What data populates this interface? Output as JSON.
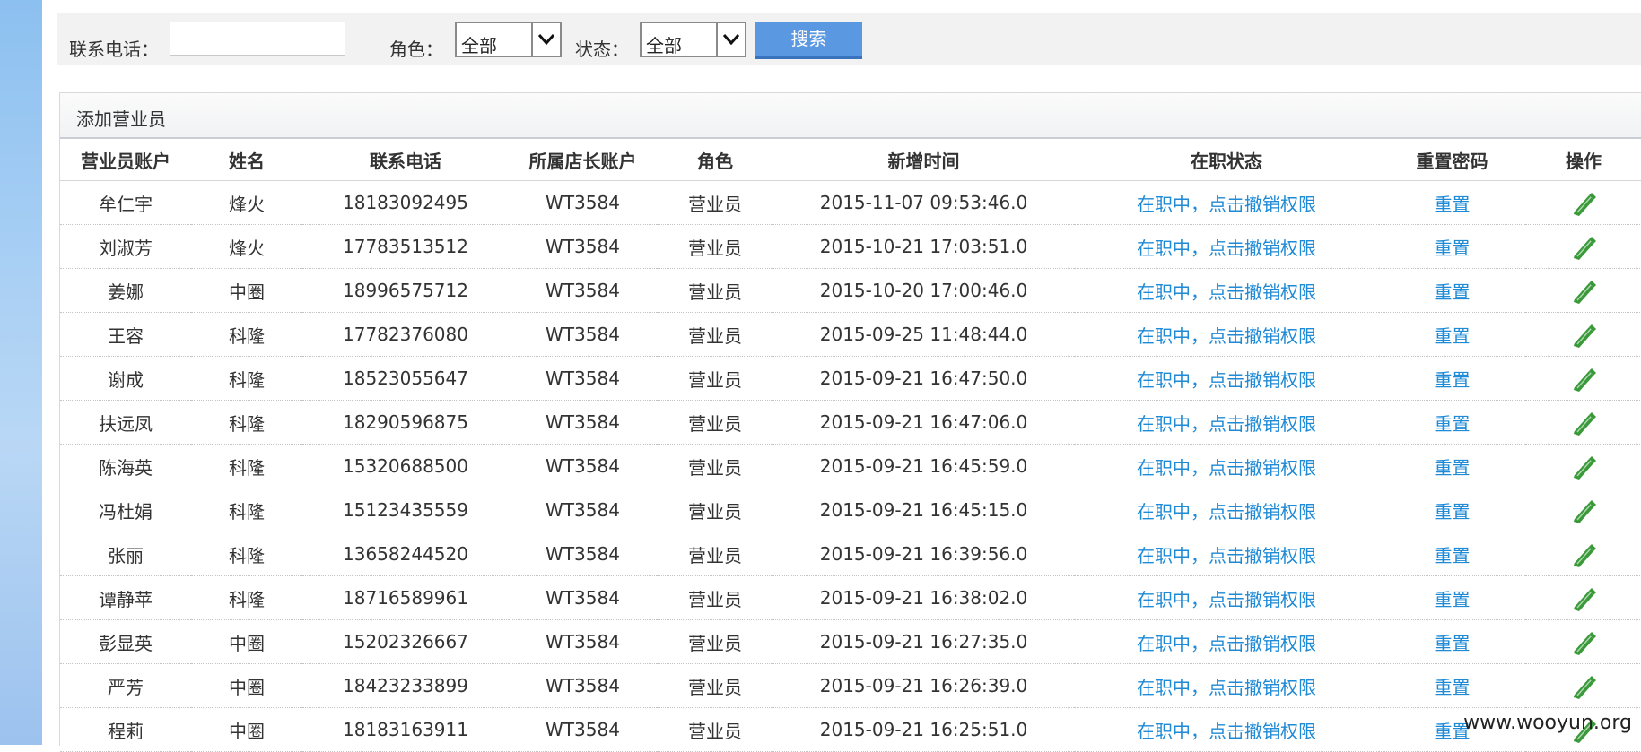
{
  "filters": {
    "phone_label": "联系电话：",
    "phone_value": "",
    "role_label": "角色：",
    "role_value": "全部",
    "status_label": "状态：",
    "status_value": "全部",
    "search_label": "搜索"
  },
  "panel": {
    "add_label": "添加营业员"
  },
  "table": {
    "headers": [
      "营业员账户",
      "姓名",
      "联系电话",
      "所属店长账户",
      "角色",
      "新增时间",
      "在职状态",
      "重置密码",
      "操作"
    ],
    "rows": [
      {
        "account": "牟仁宇",
        "name": "烽火",
        "phone": "18183092495",
        "manager": "WT3584",
        "role": "营业员",
        "time": "2015-11-07 09:53:46.0",
        "status": "在职中，点击撤销权限",
        "reset": "重置"
      },
      {
        "account": "刘淑芳",
        "name": "烽火",
        "phone": "17783513512",
        "manager": "WT3584",
        "role": "营业员",
        "time": "2015-10-21 17:03:51.0",
        "status": "在职中，点击撤销权限",
        "reset": "重置"
      },
      {
        "account": "姜娜",
        "name": "中圈",
        "phone": "18996575712",
        "manager": "WT3584",
        "role": "营业员",
        "time": "2015-10-20 17:00:46.0",
        "status": "在职中，点击撤销权限",
        "reset": "重置"
      },
      {
        "account": "王容",
        "name": "科隆",
        "phone": "17782376080",
        "manager": "WT3584",
        "role": "营业员",
        "time": "2015-09-25 11:48:44.0",
        "status": "在职中，点击撤销权限",
        "reset": "重置"
      },
      {
        "account": "谢成",
        "name": "科隆",
        "phone": "18523055647",
        "manager": "WT3584",
        "role": "营业员",
        "time": "2015-09-21 16:47:50.0",
        "status": "在职中，点击撤销权限",
        "reset": "重置"
      },
      {
        "account": "扶远凤",
        "name": "科隆",
        "phone": "18290596875",
        "manager": "WT3584",
        "role": "营业员",
        "time": "2015-09-21 16:47:06.0",
        "status": "在职中，点击撤销权限",
        "reset": "重置"
      },
      {
        "account": "陈海英",
        "name": "科隆",
        "phone": "15320688500",
        "manager": "WT3584",
        "role": "营业员",
        "time": "2015-09-21 16:45:59.0",
        "status": "在职中，点击撤销权限",
        "reset": "重置"
      },
      {
        "account": "冯杜娟",
        "name": "科隆",
        "phone": "15123435559",
        "manager": "WT3584",
        "role": "营业员",
        "time": "2015-09-21 16:45:15.0",
        "status": "在职中，点击撤销权限",
        "reset": "重置"
      },
      {
        "account": "张丽",
        "name": "科隆",
        "phone": "13658244520",
        "manager": "WT3584",
        "role": "营业员",
        "time": "2015-09-21 16:39:56.0",
        "status": "在职中，点击撤销权限",
        "reset": "重置"
      },
      {
        "account": "谭静苹",
        "name": "科隆",
        "phone": "18716589961",
        "manager": "WT3584",
        "role": "营业员",
        "time": "2015-09-21 16:38:02.0",
        "status": "在职中，点击撤销权限",
        "reset": "重置"
      },
      {
        "account": "彭显英",
        "name": "中圈",
        "phone": "15202326667",
        "manager": "WT3584",
        "role": "营业员",
        "time": "2015-09-21 16:27:35.0",
        "status": "在职中，点击撤销权限",
        "reset": "重置"
      },
      {
        "account": "严芳",
        "name": "中圈",
        "phone": "18423233899",
        "manager": "WT3584",
        "role": "营业员",
        "time": "2015-09-21 16:26:39.0",
        "status": "在职中，点击撤销权限",
        "reset": "重置"
      },
      {
        "account": "程莉",
        "name": "中圈",
        "phone": "18183163911",
        "manager": "WT3584",
        "role": "营业员",
        "time": "2015-09-21 16:25:51.0",
        "status": "在职中，点击撤销权限",
        "reset": "重置"
      }
    ],
    "edit_icon": "pencil-icon"
  },
  "colors": {
    "link": "#1f8ad6",
    "edit_icon": "#3a9a3a",
    "search_button": "#5b98e2"
  },
  "watermark": "www.wooyun.org"
}
